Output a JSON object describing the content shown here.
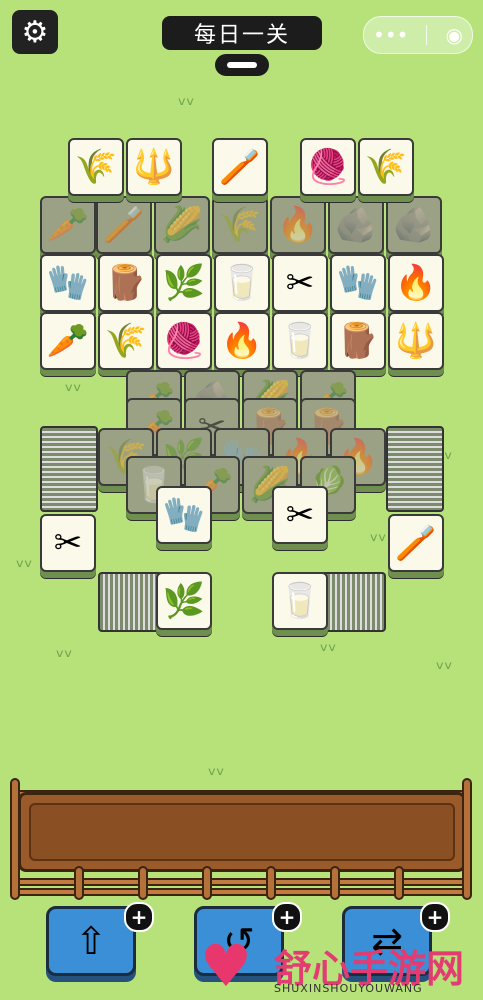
{
  "header": {
    "title": "每日一关",
    "settings_icon": "gear-icon",
    "menu_icon": "more-dots-icon",
    "close_icon": "target-circle-icon"
  },
  "watermark": {
    "text": "舒心手游网",
    "sub": "SHUXINSHOUYOUWANG"
  },
  "powerups": {
    "plus": "+"
  },
  "colors": {
    "background": "#b7e27a",
    "tile": "#fbf9ea",
    "tile_dim": "#9ba184",
    "tray": "#9a5a2a",
    "button": "#3a8fd6"
  }
}
